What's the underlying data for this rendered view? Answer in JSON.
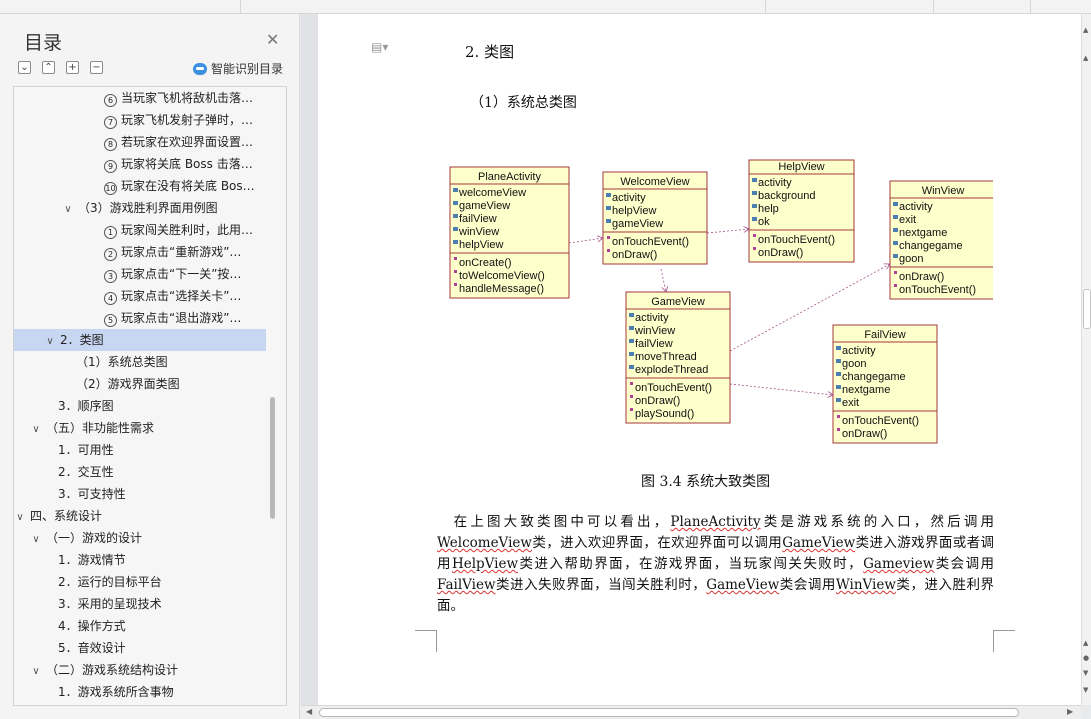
{
  "outline": {
    "title": "目录",
    "close_icon": "✕",
    "smart_button": "智能识别目录",
    "items": [
      {
        "level": 3,
        "chevron": "",
        "num": "⑥",
        "label": "当玩家飞机将敌机击落…"
      },
      {
        "level": 3,
        "chevron": "",
        "num": "⑦",
        "label": "玩家飞机发射子弹时，…"
      },
      {
        "level": 3,
        "chevron": "",
        "num": "⑧",
        "label": "若玩家在欢迎界面设置…"
      },
      {
        "level": 3,
        "chevron": "",
        "num": "⑨",
        "label": "玩家将关底 Boss 击落…"
      },
      {
        "level": 3,
        "chevron": "",
        "num": "⑩",
        "label": "玩家在没有将关底 Bos…"
      },
      {
        "level": 2,
        "chevron": "∨",
        "num": "",
        "label": "（3）游戏胜利界面用例图"
      },
      {
        "level": 3,
        "chevron": "",
        "num": "①",
        "label": "玩家闯关胜利时，此用…"
      },
      {
        "level": 3,
        "chevron": "",
        "num": "②",
        "label": "玩家点击“重新游戏”…"
      },
      {
        "level": 3,
        "chevron": "",
        "num": "③",
        "label": "玩家点击“下一关”按…"
      },
      {
        "level": 3,
        "chevron": "",
        "num": "④",
        "label": "玩家点击“选择关卡”…"
      },
      {
        "level": 3,
        "chevron": "",
        "num": "⑤",
        "label": "玩家点击“退出游戏”…"
      },
      {
        "level": 1,
        "chevron": "∨",
        "num": "",
        "label": "2．类图",
        "selected": true
      },
      {
        "level": 2,
        "chevron": "",
        "num": "",
        "label": "（1）系统总类图"
      },
      {
        "level": 2,
        "chevron": "",
        "num": "",
        "label": "（2）游戏界面类图"
      },
      {
        "level": 1,
        "chevron": "",
        "num": "",
        "label": "3．顺序图"
      },
      {
        "level": 0,
        "chevron": "∨",
        "num": "",
        "label": "（五）非功能性需求"
      },
      {
        "level": 1,
        "chevron": "",
        "num": "",
        "label": "1．可用性"
      },
      {
        "level": 1,
        "chevron": "",
        "num": "",
        "label": "2．交互性"
      },
      {
        "level": 1,
        "chevron": "",
        "num": "",
        "label": "3．可支持性"
      },
      {
        "level": -1,
        "chevron": "∨",
        "num": "",
        "label": "四、系统设计"
      },
      {
        "level": 0,
        "chevron": "∨",
        "num": "",
        "label": "（一）游戏的设计"
      },
      {
        "level": 1,
        "chevron": "",
        "num": "",
        "label": "1．游戏情节"
      },
      {
        "level": 1,
        "chevron": "",
        "num": "",
        "label": "2．运行的目标平台"
      },
      {
        "level": 1,
        "chevron": "",
        "num": "",
        "label": "3．采用的呈现技术"
      },
      {
        "level": 1,
        "chevron": "",
        "num": "",
        "label": "4．操作方式"
      },
      {
        "level": 1,
        "chevron": "",
        "num": "",
        "label": "5．音效设计"
      },
      {
        "level": 0,
        "chevron": "∨",
        "num": "",
        "label": "（二）游戏系统结构设计"
      },
      {
        "level": 1,
        "chevron": "",
        "num": "",
        "label": "1．游戏系统所含事物"
      }
    ]
  },
  "document": {
    "heading": "2. 类图",
    "subheading": "（1）系统总类图",
    "caption": "图 3.4 系统大致类图",
    "paragraph": [
      {
        "t": "在上图大致类图中可以看出，"
      },
      {
        "t": "PlaneActivity",
        "u": true
      },
      {
        "t": "类是游戏系统的入口，然后调用"
      },
      {
        "t": "WelcomeView",
        "u": true
      },
      {
        "t": "类，进入欢迎界面，在欢迎界面可以调用"
      },
      {
        "t": "GameView",
        "u": true
      },
      {
        "t": "类进入游戏界面或者调用"
      },
      {
        "t": "HelpView",
        "u": true
      },
      {
        "t": "类进入帮助界面，在游戏界面，当玩家闯关失败时，"
      },
      {
        "t": "Gameview",
        "u": true
      },
      {
        "t": "类会调用"
      },
      {
        "t": "FailView",
        "u": true
      },
      {
        "t": "类进入失败界面，当闯关胜利时，"
      },
      {
        "t": "GameView",
        "u": true
      },
      {
        "t": "类会调用"
      },
      {
        "t": "WinView",
        "u": true
      },
      {
        "t": "类，进入胜利界面。"
      }
    ]
  },
  "uml": {
    "classes": [
      {
        "key": "plane",
        "name": "PlaneActivity",
        "fields": [
          "welcomeView",
          "gameView",
          "failView",
          "winView",
          "helpView"
        ],
        "methods": [
          "onCreate()",
          "toWelcomeView()",
          "handleMessage()"
        ]
      },
      {
        "key": "welcome",
        "name": "WelcomeView",
        "fields": [
          "activity",
          "helpView",
          "gameView"
        ],
        "methods": [
          "onTouchEvent()",
          "onDraw()"
        ]
      },
      {
        "key": "help",
        "name": "HelpView",
        "fields": [
          "activity",
          "background",
          "help",
          "ok"
        ],
        "methods": [
          "onTouchEvent()",
          "onDraw()"
        ]
      },
      {
        "key": "win",
        "name": "WinView",
        "fields": [
          "activity",
          "exit",
          "nextgame",
          "changegame",
          "goon"
        ],
        "methods": [
          "onDraw()",
          "onTouchEvent()"
        ]
      },
      {
        "key": "game",
        "name": "GameView",
        "fields": [
          "activity",
          "winView",
          "failView",
          "moveThread",
          "explodeThread"
        ],
        "methods": [
          "onTouchEvent()",
          "onDraw()",
          "playSound()"
        ]
      },
      {
        "key": "fail",
        "name": "FailView",
        "fields": [
          "activity",
          "goon",
          "changegame",
          "nextgame",
          "exit"
        ],
        "methods": [
          "onTouchEvent()",
          "onDraw()"
        ]
      }
    ],
    "colors": {
      "fill": "#ffffcc",
      "border": "#a33a3a",
      "arrow": "#a3508a"
    }
  }
}
